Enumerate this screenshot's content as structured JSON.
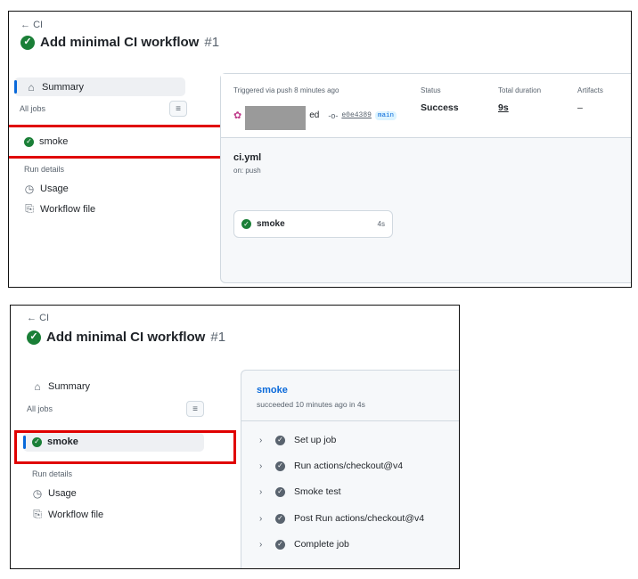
{
  "shot1": {
    "back_label": "CI",
    "title": "Add minimal CI workflow",
    "run_number": "#1",
    "nav": {
      "summary": "Summary",
      "all_jobs": "All jobs",
      "job": "smoke",
      "run_details": "Run details",
      "usage": "Usage",
      "workflow_file": "Workflow file"
    },
    "summary": {
      "triggered": "Triggered via push 8 minutes ago",
      "actor_suffix": "ed",
      "sha": "e0e4389",
      "branch": "main",
      "status_label": "Status",
      "status_value": "Success",
      "duration_label": "Total duration",
      "duration_value": "9s",
      "artifacts_label": "Artifacts",
      "artifacts_value": "–"
    },
    "graph": {
      "file": "ci.yml",
      "trigger": "on: push",
      "job_name": "smoke",
      "job_duration": "4s"
    }
  },
  "shot2": {
    "back_label": "CI",
    "title": "Add minimal CI workflow",
    "run_number": "#1",
    "nav": {
      "summary": "Summary",
      "all_jobs": "All jobs",
      "job": "smoke",
      "run_details": "Run details",
      "usage": "Usage",
      "workflow_file": "Workflow file"
    },
    "job": {
      "name": "smoke",
      "status": "succeeded 10 minutes ago in 4s",
      "steps": [
        {
          "label": "Set up job"
        },
        {
          "label": "Run actions/checkout@v4"
        },
        {
          "label": "Smoke test"
        },
        {
          "label": "Post Run actions/checkout@v4"
        },
        {
          "label": "Complete job"
        }
      ]
    }
  },
  "colors": {
    "success": "#1a7f37",
    "highlight": "#e00000",
    "accent": "#0969da"
  },
  "icons": {
    "back": "arrow-left-icon",
    "status": "check-circle-fill-icon",
    "summary": "home-icon",
    "filter": "filter-icon",
    "usage": "stopwatch-icon",
    "workflow_file": "file-code-icon",
    "commit": "git-commit-icon",
    "step_expand": "chevron-right-icon"
  }
}
